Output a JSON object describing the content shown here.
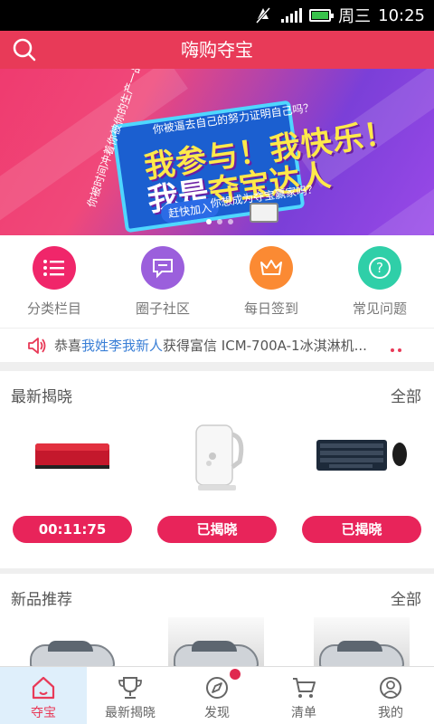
{
  "status_bar": {
    "day": "周三",
    "time": "10:25"
  },
  "app_bar": {
    "title": "嗨购夺宝"
  },
  "banner": {
    "top_line": "你被逼去自己的努力证明自己吗？",
    "side_line": "你被时间冲着你被你的生产一品吗？",
    "headline_1": "我参与！我快乐！",
    "headline_2_a": "我是",
    "headline_2_b": "夺宝达人",
    "pill": "赶快加入",
    "sub": "你想成为夺宝赢家吗？"
  },
  "shortcuts": [
    {
      "label": "分类栏目",
      "icon": "list-icon",
      "color": "#f0266a"
    },
    {
      "label": "圈子社区",
      "icon": "chat-icon",
      "color": "#9b5fdc"
    },
    {
      "label": "每日签到",
      "icon": "crown-icon",
      "color": "#fb8a33"
    },
    {
      "label": "常见问题",
      "icon": "question-icon",
      "color": "#2fcfa8"
    }
  ],
  "ticker": {
    "prefix": "恭喜",
    "name": "我姓李我新人",
    "suffix": "获得富信 ICM-700A-1冰淇淋机..."
  },
  "latest": {
    "title": "最新揭晓",
    "all": "全部",
    "items": [
      {
        "product": "red-hard-drive",
        "button": "00:11:75"
      },
      {
        "product": "electric-kettle",
        "button": "已揭晓"
      },
      {
        "product": "keyboard-mouse",
        "button": "已揭晓"
      }
    ]
  },
  "new_products": {
    "title": "新品推荐",
    "all": "全部"
  },
  "tabs": [
    {
      "label": "夺宝",
      "icon": "home-icon",
      "active": true
    },
    {
      "label": "最新揭晓",
      "icon": "trophy-icon",
      "active": false
    },
    {
      "label": "发现",
      "icon": "compass-icon",
      "active": false
    },
    {
      "label": "清单",
      "icon": "cart-icon",
      "active": false
    },
    {
      "label": "我的",
      "icon": "user-icon",
      "active": false
    }
  ],
  "colors": {
    "brand": "#e83a58",
    "button": "#e8245a",
    "link": "#3a7fd6"
  }
}
